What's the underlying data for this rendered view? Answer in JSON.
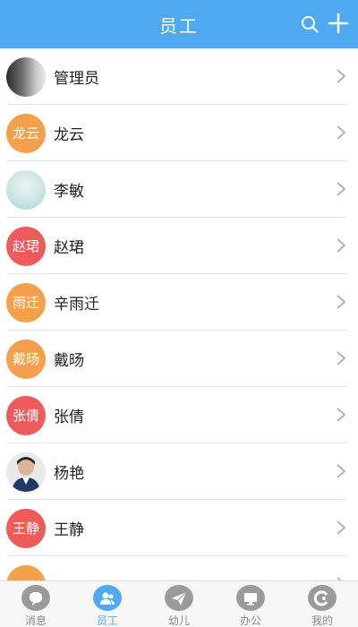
{
  "header": {
    "title": "员工"
  },
  "staff": [
    {
      "name": "管理员",
      "avatar_text": "",
      "avatar_kind": "photo-dark"
    },
    {
      "name": "龙云",
      "avatar_text": "龙云",
      "avatar_kind": "orange"
    },
    {
      "name": "李敏",
      "avatar_text": "",
      "avatar_kind": "photo-light"
    },
    {
      "name": "赵珺",
      "avatar_text": "赵珺",
      "avatar_kind": "red"
    },
    {
      "name": "辛雨迁",
      "avatar_text": "雨迁",
      "avatar_kind": "orange"
    },
    {
      "name": "戴旸",
      "avatar_text": "戴旸",
      "avatar_kind": "orange"
    },
    {
      "name": "张倩",
      "avatar_text": "张倩",
      "avatar_kind": "red"
    },
    {
      "name": "杨艳",
      "avatar_text": "",
      "avatar_kind": "photo-person"
    },
    {
      "name": "王静",
      "avatar_text": "王静",
      "avatar_kind": "red"
    }
  ],
  "tabs": [
    {
      "label": "消息",
      "icon": "chat-bubble-icon",
      "active": false
    },
    {
      "label": "员工",
      "icon": "people-icon",
      "active": true
    },
    {
      "label": "幼儿",
      "icon": "paper-plane-icon",
      "active": false
    },
    {
      "label": "办公",
      "icon": "monitor-icon",
      "active": false
    },
    {
      "label": "我的",
      "icon": "profile-icon",
      "active": false
    }
  ],
  "colors": {
    "header": "#4ea9f0",
    "accent": "#4ea9f0",
    "avatar_orange": "#f5a04a",
    "avatar_red": "#ef5b5b",
    "tab_inactive": "#9a9a9a"
  }
}
